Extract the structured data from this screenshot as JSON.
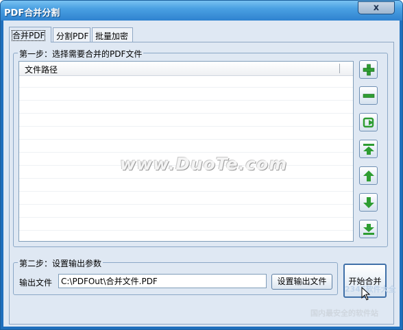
{
  "window": {
    "title": "PDF合并分割",
    "close_symbol": "x"
  },
  "tabs": [
    {
      "label": "合并PDF",
      "active": true
    },
    {
      "label": "分割PDF",
      "active": false
    },
    {
      "label": "批量加密",
      "active": false
    }
  ],
  "step1": {
    "label": "第一步：选择需要合并的PDF文件",
    "list_column": "文件路径",
    "rows": []
  },
  "side_buttons": [
    {
      "name": "add-file-button",
      "icon": "plus-icon"
    },
    {
      "name": "remove-file-button",
      "icon": "minus-icon"
    },
    {
      "name": "clear-list-button",
      "icon": "refresh-icon"
    },
    {
      "name": "move-top-button",
      "icon": "move-top-icon"
    },
    {
      "name": "move-up-button",
      "icon": "arrow-up-icon"
    },
    {
      "name": "move-down-button",
      "icon": "arrow-down-icon"
    },
    {
      "name": "move-bottom-button",
      "icon": "move-bottom-icon"
    }
  ],
  "step2": {
    "label": "第二步：设置输出参数",
    "output_label": "输出文件",
    "output_value": "C:\\PDFOut\\合并文件.PDF",
    "set_output_button": "设置输出文件"
  },
  "start_button": "开始合并",
  "watermarks": {
    "main": "www.DuoTe.com",
    "secondary": "2345软件大全",
    "footer": "国内最安全的软件站"
  },
  "colors": {
    "titlebar": "#3f93d9",
    "client": "#dfe8f3",
    "icon_green": "#2e9d32"
  }
}
